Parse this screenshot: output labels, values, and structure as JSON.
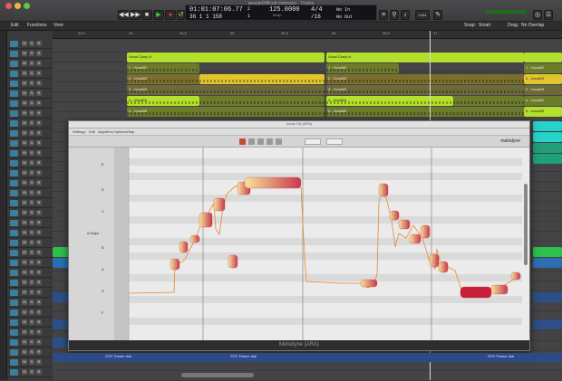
{
  "window": {
    "title": "peopleDifficult-company - Tracks"
  },
  "transport": {
    "buttons": [
      "◀◀",
      "▶▶",
      "■",
      "▶",
      "●",
      "↺"
    ]
  },
  "lcd": {
    "time": "01:01:07:06.77",
    "bars": "36   1   1   158",
    "beat_a": "2",
    "beat_b": "1",
    "tempo": "125.0000",
    "sig": "4/4",
    "div": "/16",
    "keep": "Keep",
    "in_label": "No In",
    "out_label": "No Out"
  },
  "menubar": {
    "items": [
      "Edit",
      "Functions",
      "View"
    ],
    "right": [
      "Snap:",
      "Smart",
      "Drag:",
      "No Overlap"
    ]
  },
  "ruler": {
    "ticks": [
      "33.5",
      "34",
      "34.5",
      "35",
      "35.5",
      "36",
      "36.5",
      "37"
    ]
  },
  "tracks": {
    "count": 34
  },
  "regions": {
    "comp_a": "Vocal Comp A",
    "comp_b": "Vocal Comp A",
    "takes": [
      "1 - Vocal02",
      "2 - Vocal03",
      "3 - Vocal03",
      "4 - Vocal04",
      "5 - Vocal05"
    ]
  },
  "melodyne": {
    "title": "Vocal 1/6 (ARA)",
    "menu": [
      "Settings",
      "Edit",
      "Algorithm",
      "Options",
      "Help"
    ],
    "logo": "melodyne",
    "footer": "Melodyne (ARA)",
    "key_label": "A Major",
    "pitch_labels": [
      "E",
      "D",
      "C",
      "B",
      "A",
      "G",
      "F"
    ]
  },
  "bottom": {
    "labels": [
      "STR Theme dub",
      "STR Theme dub",
      "STR Theme dub"
    ]
  },
  "colors": {
    "region_green": "#b3e02a",
    "region_yellow": "#e0c62a",
    "region_cyan": "#27d3c8",
    "blob": "#e8a050",
    "blob_red": "#c8203a"
  }
}
